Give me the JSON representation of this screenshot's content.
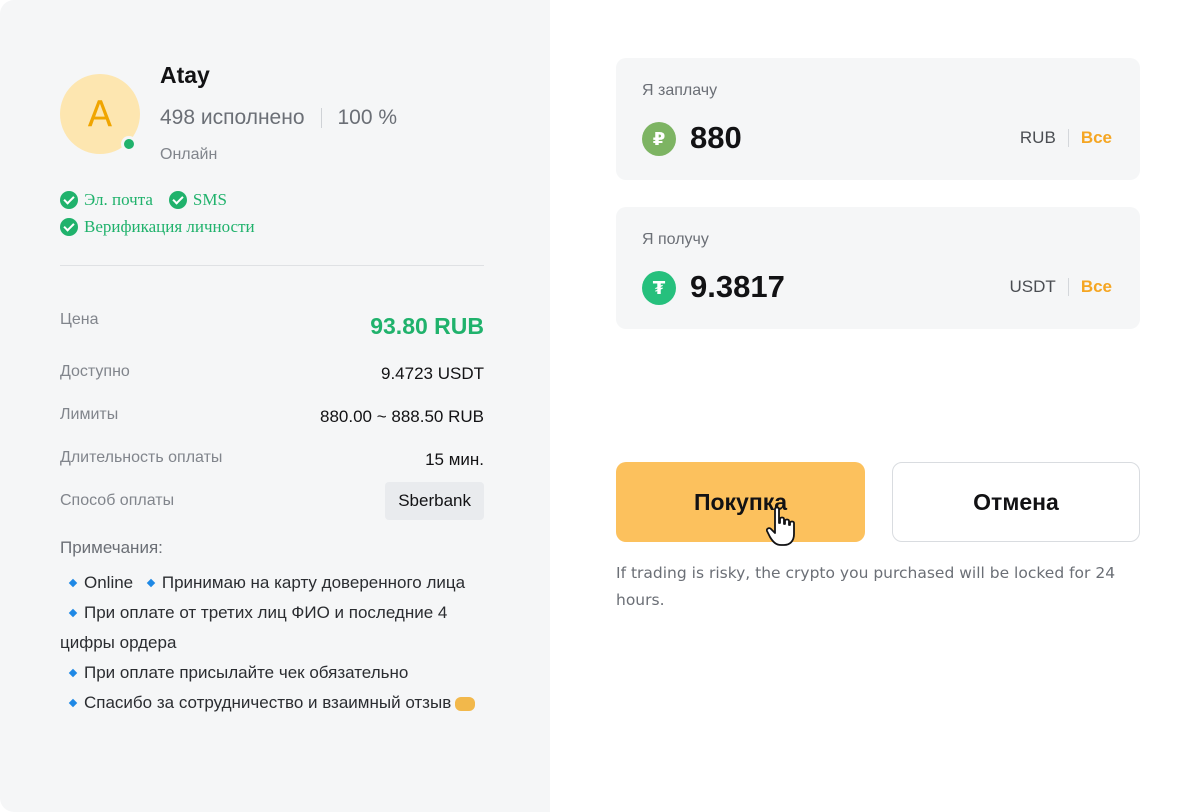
{
  "merchant": {
    "avatar_letter": "A",
    "name": "Atay",
    "orders_completed": "498 исполнено",
    "completion_rate": "100 %",
    "status": "Онлайн",
    "verifications": [
      "Эл. почта",
      "SMS",
      "Верификация личности"
    ]
  },
  "details": {
    "price_label": "Цена",
    "price_value": "93.80 RUB",
    "available_label": "Доступно",
    "available_value": "9.4723 USDT",
    "limits_label": "Лимиты",
    "limits_value": "880.00 ~ 888.50 RUB",
    "duration_label": "Длительность оплаты",
    "duration_value": "15 мин.",
    "method_label": "Способ оплаты",
    "method_value": "Sberbank"
  },
  "notes": {
    "title": "Примечания:",
    "items": [
      "Online",
      "Принимаю на карту доверенного лица",
      "При оплате от третих лиц ФИО и последние 4 цифры ордера",
      "При оплате присылайте чек обязательно",
      "Спасибо за сотрудничество и взаимный отзыв"
    ]
  },
  "pay": {
    "label": "Я заплачу",
    "coin_symbol": "₽",
    "amount": "880",
    "currency": "RUB",
    "max_label": "Все"
  },
  "receive": {
    "label": "Я получу",
    "coin_symbol": "₮",
    "amount": "9.3817",
    "currency": "USDT",
    "max_label": "Все"
  },
  "actions": {
    "buy_label": "Покупка",
    "cancel_label": "Отмена"
  },
  "risk_notice": "If trading is risky, the crypto you purchased will be locked for 24 hours.",
  "colors": {
    "accent": "#fcc15d",
    "success": "#20b26c",
    "link": "#f5a623"
  }
}
